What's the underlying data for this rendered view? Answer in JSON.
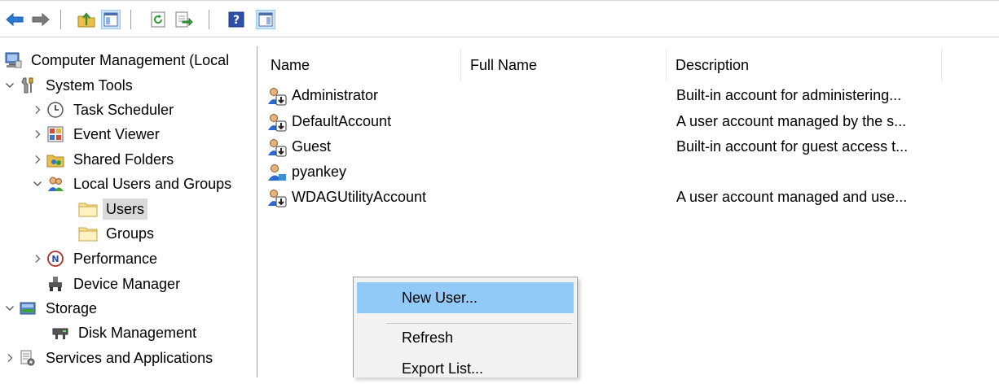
{
  "toolbar": {
    "buttons": [
      {
        "name": "back-button",
        "icon": "arrow-left-icon"
      },
      {
        "name": "forward-button",
        "icon": "arrow-right-icon"
      },
      {
        "name": "up-one-level-button",
        "icon": "folder-up-icon"
      },
      {
        "name": "show-hide-console-tree-button",
        "icon": "console-tree-icon"
      },
      {
        "name": "refresh-button",
        "icon": "refresh-icon"
      },
      {
        "name": "export-list-button",
        "icon": "export-icon"
      },
      {
        "name": "help-button",
        "icon": "help-icon"
      },
      {
        "name": "show-hide-action-pane-button",
        "icon": "action-pane-icon"
      }
    ]
  },
  "tree": {
    "items": [
      {
        "label": "Computer Management (Local",
        "icon": "computer-management-icon",
        "chevron": ""
      },
      {
        "label": "System Tools",
        "icon": "system-tools-icon",
        "chevron": "expanded"
      },
      {
        "label": "Task Scheduler",
        "icon": "clock-icon",
        "chevron": "collapsed"
      },
      {
        "label": "Event Viewer",
        "icon": "event-viewer-icon",
        "chevron": "collapsed"
      },
      {
        "label": "Shared Folders",
        "icon": "shared-folders-icon",
        "chevron": "collapsed"
      },
      {
        "label": "Local Users and Groups",
        "icon": "users-groups-icon",
        "chevron": "expanded"
      },
      {
        "label": "Users",
        "icon": "folder-icon",
        "chevron": "",
        "selected": true
      },
      {
        "label": "Groups",
        "icon": "folder-icon",
        "chevron": ""
      },
      {
        "label": "Performance",
        "icon": "performance-icon",
        "chevron": "collapsed"
      },
      {
        "label": "Device Manager",
        "icon": "device-manager-icon",
        "chevron": ""
      },
      {
        "label": "Storage",
        "icon": "storage-icon",
        "chevron": "expanded"
      },
      {
        "label": "Disk Management",
        "icon": "disk-management-icon",
        "chevron": ""
      },
      {
        "label": "Services and Applications",
        "icon": "services-icon",
        "chevron": "collapsed"
      }
    ]
  },
  "list": {
    "columns": [
      "Name",
      "Full Name",
      "Description"
    ],
    "rows": [
      {
        "name": "Administrator",
        "full_name": "",
        "description": "Built-in account for administering...",
        "disabled": true
      },
      {
        "name": "DefaultAccount",
        "full_name": "",
        "description": "A user account managed by the s...",
        "disabled": true
      },
      {
        "name": "Guest",
        "full_name": "",
        "description": "Built-in account for guest access t...",
        "disabled": true
      },
      {
        "name": "pyankey",
        "full_name": "",
        "description": "",
        "disabled": false
      },
      {
        "name": "WDAGUtilityAccount",
        "full_name": "",
        "description": "A user account managed and use...",
        "disabled": true
      }
    ]
  },
  "context_menu": {
    "items": [
      {
        "label": "New User...",
        "highlighted": true
      },
      {
        "label": "Refresh"
      },
      {
        "label": "Export List..."
      }
    ]
  },
  "colors": {
    "menu_highlight": "#91c9f7",
    "selection": "#d9d9d9",
    "toolbar_toggle": "#cce4f7"
  }
}
